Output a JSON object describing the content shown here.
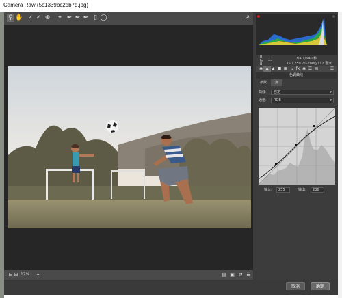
{
  "window": {
    "title": "Camera Raw (5c1339bc2db7d.jpg)"
  },
  "toolbar": {
    "tools": [
      "zoom-icon",
      "hand-icon",
      "white-balance-icon",
      "color-sampler-icon",
      "targeted-adjust-icon",
      "crop-icon",
      "straighten-icon",
      "spot-removal-icon",
      "red-eye-icon",
      "adjustment-brush-icon",
      "graduated-filter-icon",
      "radial-filter-icon"
    ],
    "fullscreen_icon": "fullscreen-icon"
  },
  "bottom": {
    "zoom": "17%"
  },
  "info": {
    "r": "R",
    "g": "G",
    "b": "B",
    "dash_r": "---",
    "dash_g": "---",
    "dash_b": "---",
    "line1": "f/4   1/640 秒",
    "line2": "ISO 250   70-200@112 毫米"
  },
  "panel": {
    "title": "色调曲线",
    "tabs": [
      "参数",
      "点"
    ],
    "curve_label": "曲线:",
    "curve_value": "自定",
    "channel_label": "通道:",
    "channel_value": "RGB",
    "input_label": "输入:",
    "input_value": "255",
    "output_label": "输出:",
    "output_value": "236"
  },
  "footer": {
    "cancel": "取消",
    "ok": "确定"
  },
  "colors": {
    "panel_bg": "#3c3c3c",
    "canvas_bg": "#262626",
    "accent": "#d42020"
  }
}
